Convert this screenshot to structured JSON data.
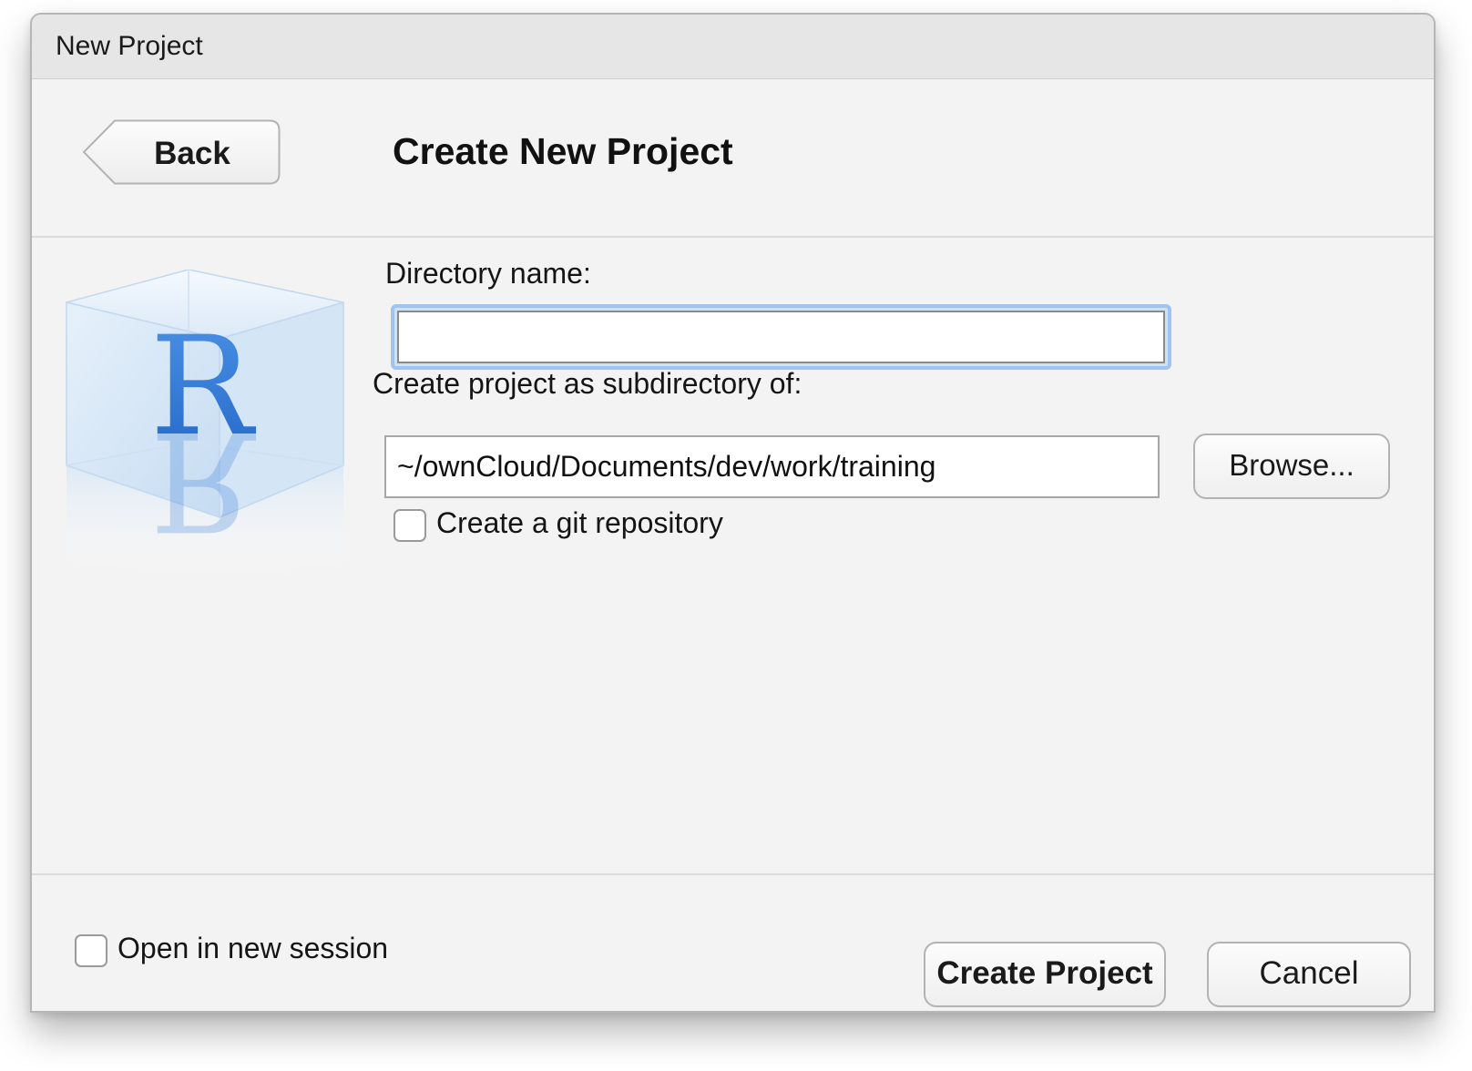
{
  "window": {
    "title": "New Project"
  },
  "header": {
    "back_label": "Back",
    "page_title": "Create New Project"
  },
  "logo": {
    "icon": "r-logo-cube-icon",
    "letter": "R"
  },
  "form": {
    "directory_name_label": "Directory name:",
    "directory_name_value": "",
    "subdirectory_label": "Create project as subdirectory of:",
    "subdirectory_value": "~/ownCloud/Documents/dev/work/training",
    "browse_label": "Browse...",
    "git_repo_label": "Create a git repository",
    "git_repo_checked": false
  },
  "footer": {
    "new_session_label": "Open in new session",
    "new_session_checked": false,
    "create_label": "Create Project",
    "cancel_label": "Cancel"
  },
  "colors": {
    "window_bg": "#f3f3f3",
    "titlebar_bg": "#e6e6e6",
    "focus_ring": "#9fc4ef",
    "r_blue": "#2f79d8"
  }
}
